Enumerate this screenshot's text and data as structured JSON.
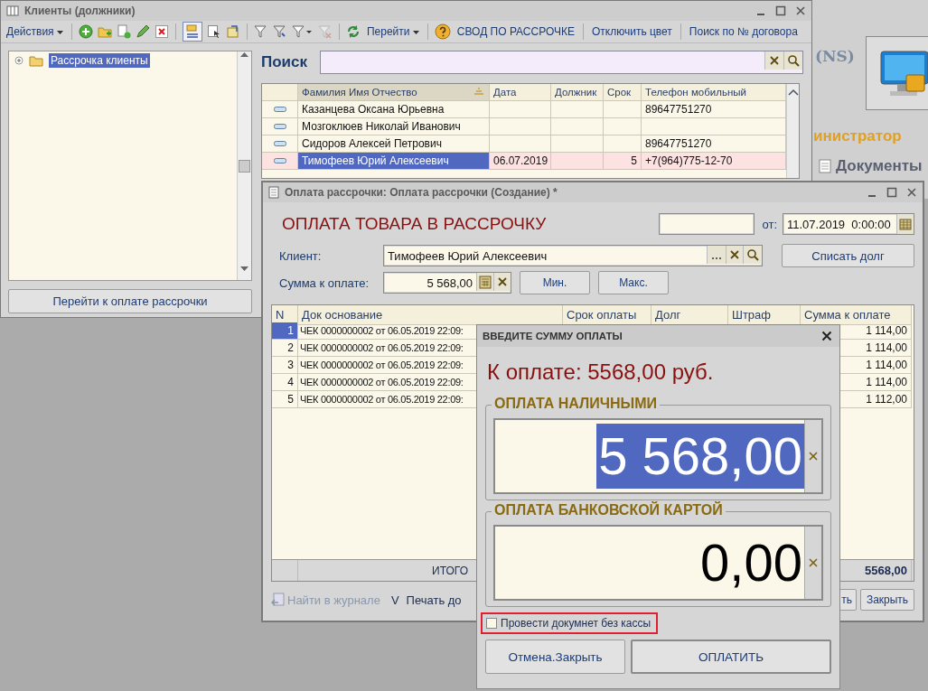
{
  "background_app": {
    "brand": "(NS)",
    "role": "инистратор",
    "documents": "Документы"
  },
  "clients_window": {
    "title": "Клиенты (должники)",
    "toolbar": {
      "actions": "Действия",
      "list_mode_pressed": true,
      "goto": "Перейти",
      "summary": "СВОД ПО РАССРОЧКЕ",
      "color_off": "Отключить цвет",
      "contract_search": "Поиск по № договора"
    },
    "tree": [
      {
        "label": "Рассрочка клиенты",
        "selected": true
      }
    ],
    "pay_button": "Перейти к оплате рассрочки",
    "search_label": "Поиск",
    "table": {
      "columns": [
        "Фамилия Имя Отчество",
        "Дата",
        "Должник",
        "Срок",
        "Телефон мобильный"
      ],
      "rows": [
        {
          "name": "Казанцева Оксана Юрьевна",
          "phone": "89647751270",
          "selected": false
        },
        {
          "name": "Мозгоклюев Николай Иванович",
          "selected": false
        },
        {
          "name": "Сидоров Алексей Петрович",
          "phone": "89647751270",
          "selected": false
        },
        {
          "name": "Тимофеев Юрий Алексеевич",
          "date": "06.07.2019",
          "term": "5",
          "phone": "+7(964)775-12-70",
          "selected": true
        }
      ]
    }
  },
  "payment_window": {
    "title": "Оплата рассрочки: Оплата рассрочки (Создание) *",
    "heading": "ОПЛАТА ТОВАРА В РАССРОЧКУ",
    "date_label": "от:",
    "date": "11.07.2019  0:00:00",
    "client_label": "Клиент:",
    "client": "Тимофеев Юрий Алексеевич",
    "write_off": "Списать долг",
    "sum_label": "Сумма к оплате:",
    "sum": "5 568,00",
    "min": "Мин.",
    "max": "Макс.",
    "table": {
      "columns": [
        "N",
        "Док основание",
        "Срок оплаты",
        "Долг",
        "Штраф",
        "Сумма к оплате"
      ],
      "rows": [
        {
          "n": "1",
          "doc": "ЧЕК 0000000002 от 06.05.2019 22:09:",
          "amount": "1 114,00",
          "selected": true
        },
        {
          "n": "2",
          "doc": "ЧЕК 0000000002 от 06.05.2019 22:09:",
          "amount": "1 114,00",
          "selected": false
        },
        {
          "n": "3",
          "doc": "ЧЕК 0000000002 от 06.05.2019 22:09:",
          "amount": "1 114,00",
          "selected": false
        },
        {
          "n": "4",
          "doc": "ЧЕК 0000000002 от 06.05.2019 22:09:",
          "amount": "1 114,00",
          "selected": false
        },
        {
          "n": "5",
          "doc": "ЧЕК 0000000002 от 06.05.2019 22:09:",
          "amount": "1 112,00",
          "selected": false
        }
      ],
      "total_label": "ИТОГО",
      "total": "5568,00"
    },
    "find_journal": {
      "label": "Найти в журнале",
      "disabled": true
    },
    "v_label": "V",
    "print": "Печать до",
    "cut_button": "ть",
    "close": "Закрыть"
  },
  "dialog": {
    "title": "ВВЕДИТЕ СУММУ ОПЛАТЫ",
    "due": "К оплате: 5568,00 руб.",
    "cash": {
      "legend": "ОПЛАТА НАЛИЧНЫМИ",
      "value": "5 568,00",
      "selected": true
    },
    "card": {
      "legend": "ОПЛАТА БАНКОВСКОЙ КАРТОЙ",
      "value": "0,00",
      "selected": false
    },
    "no_register": {
      "label": "Провести докумнет без кассы",
      "checked": false
    },
    "cancel": "Отмена.Закрыть",
    "pay": "ОПЛАТИТЬ"
  }
}
